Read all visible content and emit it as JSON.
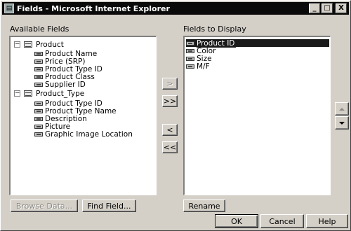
{
  "window": {
    "title": "Fields - Microsoft Internet Explorer",
    "minimize": "_",
    "maximize": "□",
    "close": "X"
  },
  "available": {
    "label": "Available Fields",
    "tables": [
      {
        "name": "Product",
        "expander": "−",
        "fields": [
          "Product Name",
          "Price (SRP)",
          "Product Type ID",
          "Product Class",
          "Supplier ID"
        ]
      },
      {
        "name": "Product_Type",
        "expander": "−",
        "fields": [
          "Product Type ID",
          "Product Type Name",
          "Description",
          "Picture",
          "Graphic Image Location"
        ]
      }
    ]
  },
  "display": {
    "label": "Fields to Display",
    "fields": [
      "Product ID",
      "Color",
      "Size",
      "M/F"
    ],
    "selected_index": 0
  },
  "buttons": {
    "add": ">",
    "add_all": ">>",
    "remove": "<",
    "remove_all": "<<",
    "browse": "Browse Data...",
    "find": "Find Field...",
    "rename": "Rename",
    "ok": "OK",
    "cancel": "Cancel",
    "help": "Help"
  }
}
